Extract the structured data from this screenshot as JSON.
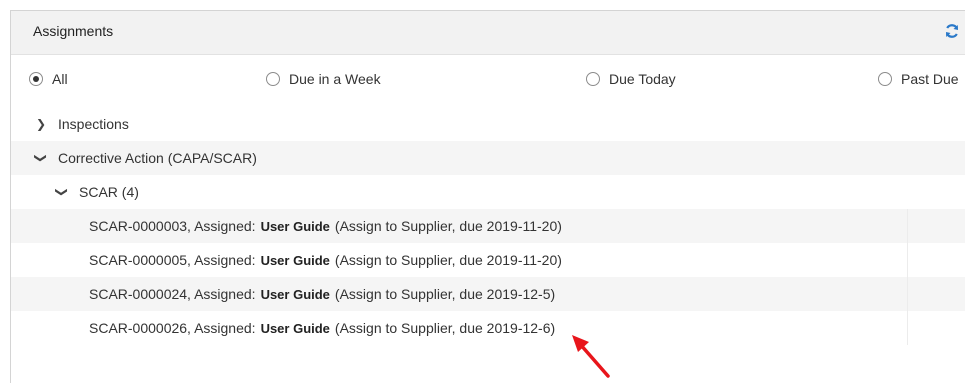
{
  "panel": {
    "title": "Assignments",
    "refresh_icon": "refresh-icon"
  },
  "filters": [
    {
      "label": "All",
      "checked": true
    },
    {
      "label": "Due in a Week",
      "checked": false
    },
    {
      "label": "Due Today",
      "checked": false
    },
    {
      "label": "Past Due",
      "checked": false
    }
  ],
  "tree": {
    "inspections": {
      "label": "Inspections",
      "expanded": false
    },
    "corrective_action": {
      "label": "Corrective Action (CAPA/SCAR)",
      "expanded": true
    },
    "scar_group": {
      "label": "SCAR (4)",
      "expanded": true
    },
    "items": [
      {
        "id_text": "SCAR-0000003, Assigned:",
        "user": "User Guide",
        "detail": "(Assign to Supplier, due 2019-11-20)"
      },
      {
        "id_text": "SCAR-0000005, Assigned:",
        "user": "User Guide",
        "detail": "(Assign to Supplier, due 2019-11-20)"
      },
      {
        "id_text": "SCAR-0000024, Assigned:",
        "user": "User Guide",
        "detail": "(Assign to Supplier, due 2019-12-5)"
      },
      {
        "id_text": "SCAR-0000026, Assigned:",
        "user": "User Guide",
        "detail": "(Assign to Supplier, due 2019-12-6)"
      }
    ]
  },
  "colors": {
    "accent": "#2a79c9",
    "annotation_arrow": "#e8151b"
  }
}
